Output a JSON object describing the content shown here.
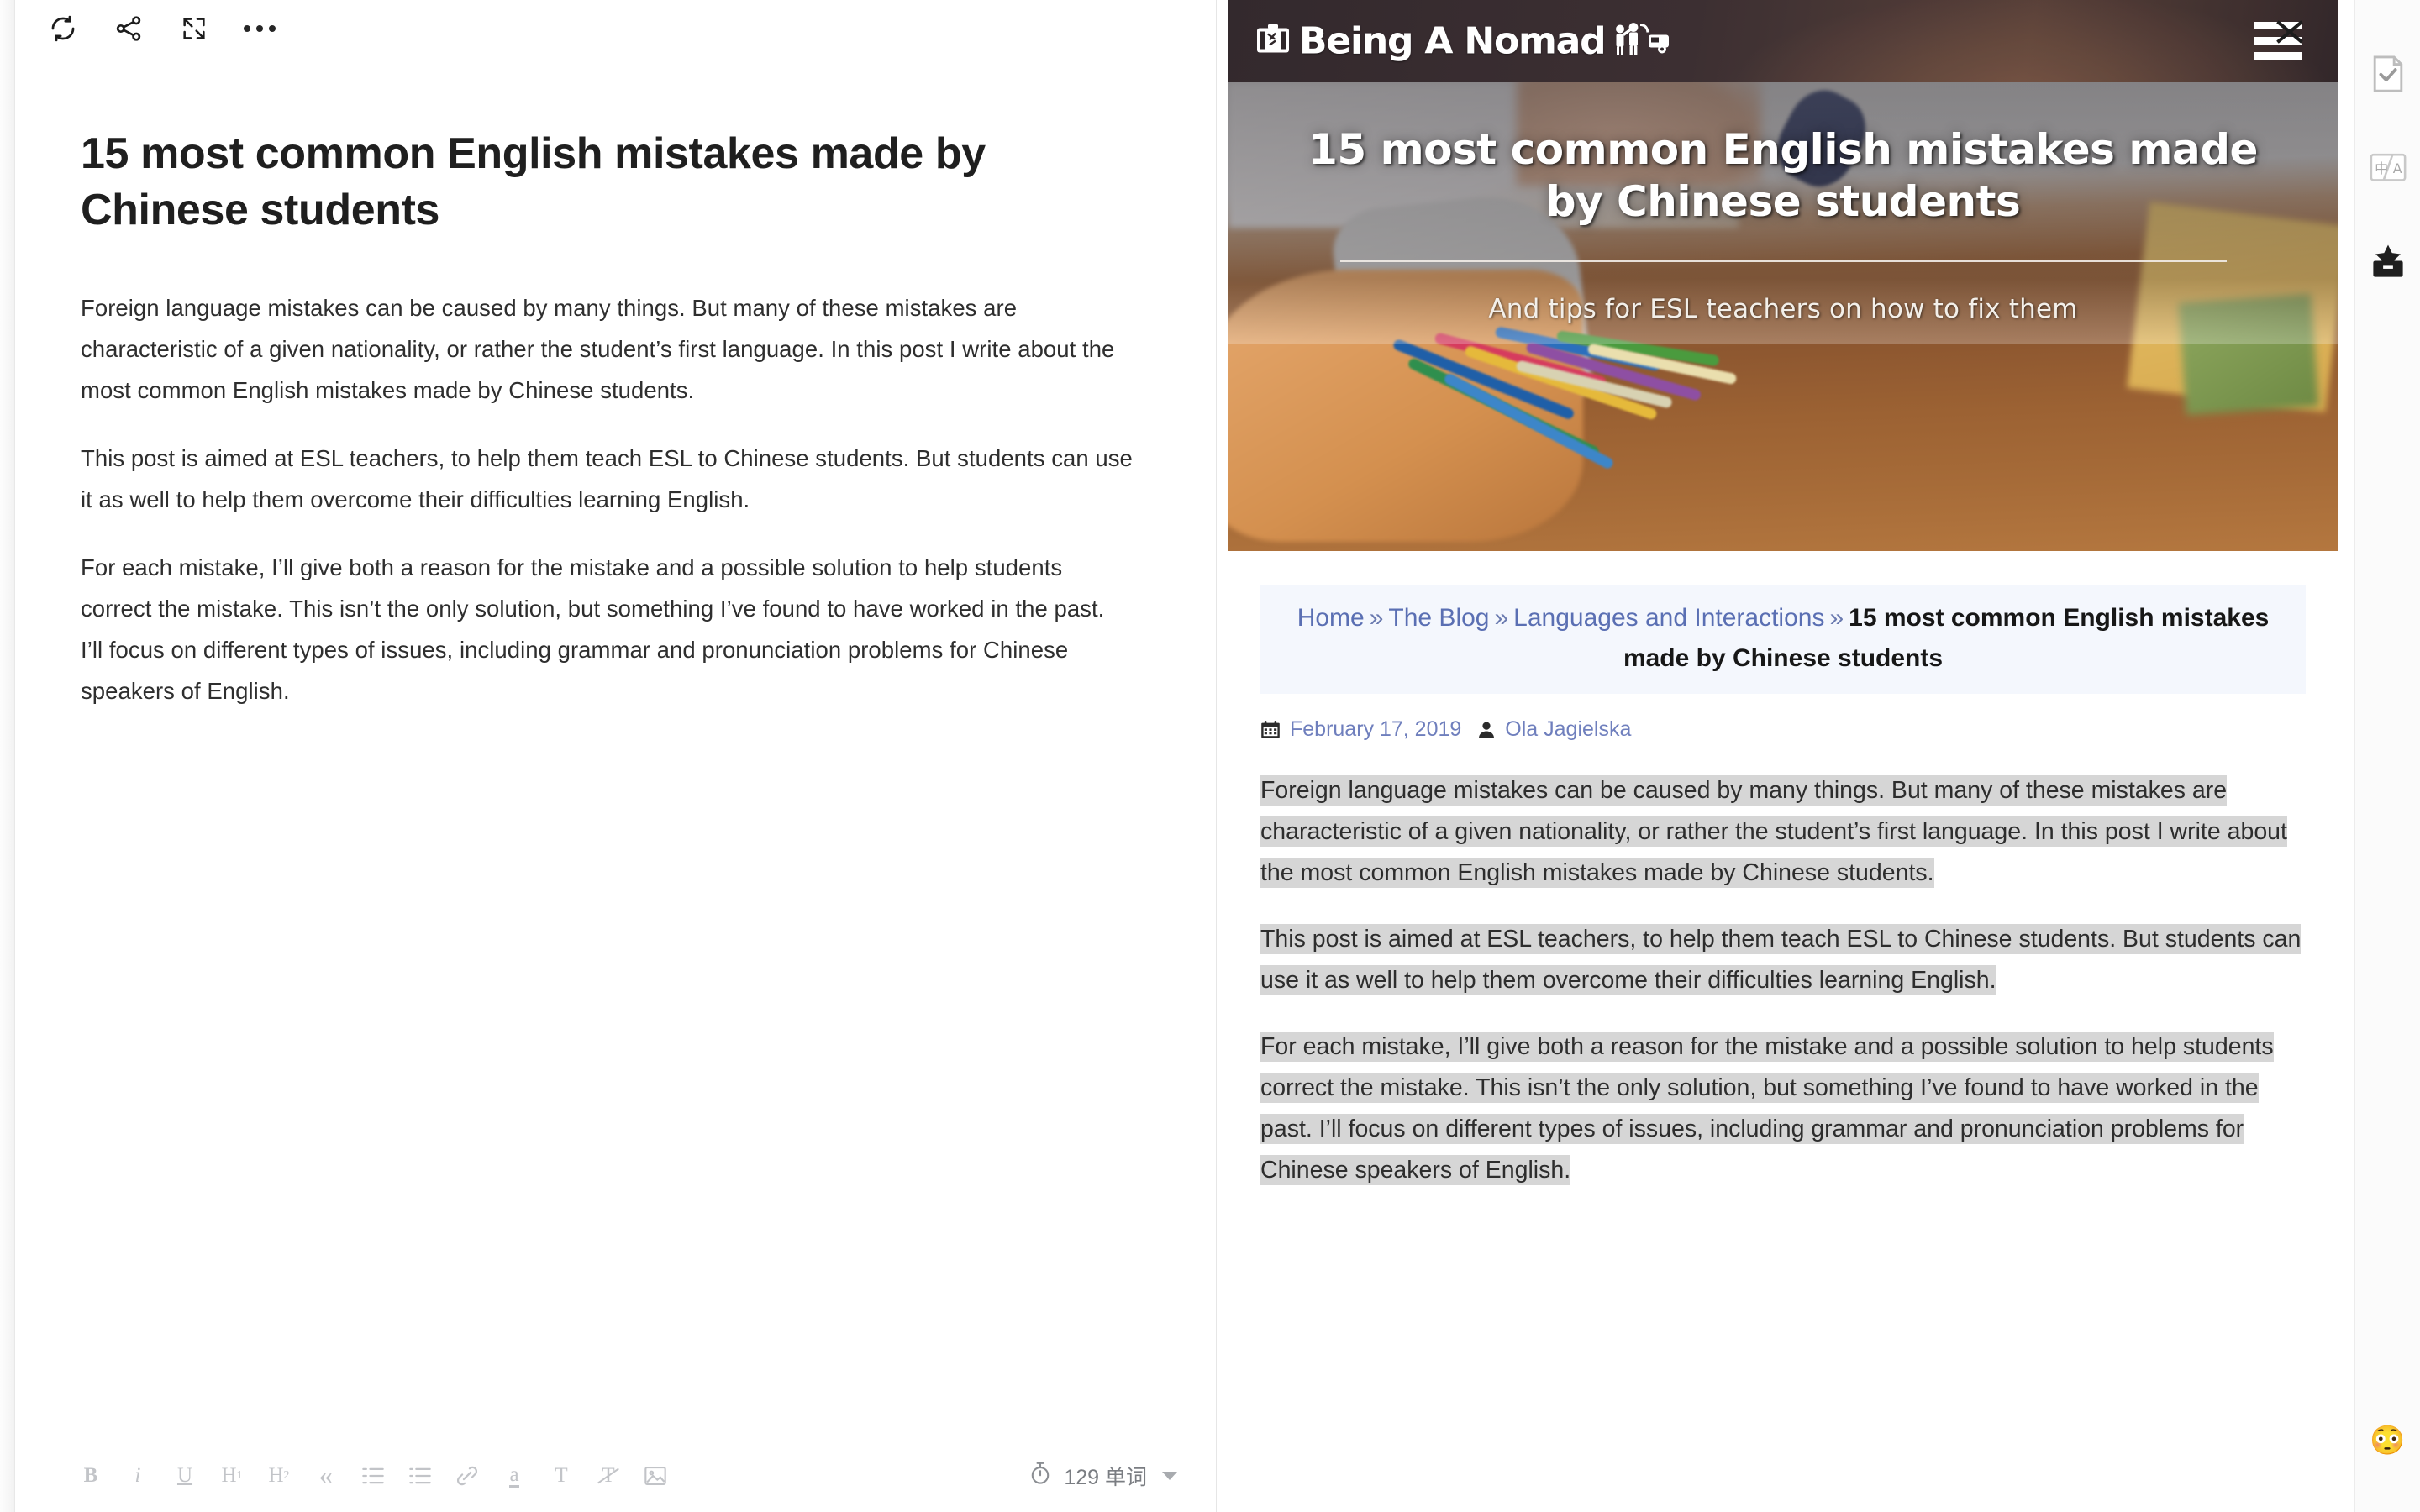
{
  "editor": {
    "toolbar_top": [
      {
        "name": "refresh-sync-icon",
        "label": "Sync"
      },
      {
        "name": "share-icon",
        "label": "Share"
      },
      {
        "name": "fullscreen-icon",
        "label": "Fullscreen"
      },
      {
        "name": "more-options-icon",
        "label": "More"
      }
    ],
    "title": "15 most common English mistakes made by Chinese students",
    "paragraphs": [
      "Foreign language mistakes can be caused by many things. But many of these mistakes are characteristic of a given nationality, or rather the student’s first language. In this post I write about the most common English mistakes made by Chinese students.",
      "This post is aimed at ESL teachers, to help them teach ESL to Chinese students. But students can use it as well to help them overcome their difficulties learning English.",
      "For each mistake, I’ll give both a reason for the mistake and a possible solution to help students correct the mistake. This isn’t the only solution, but something I’ve found to have worked in the past. I’ll focus on different types of issues, including grammar and pronunciation problems for Chinese speakers of English."
    ],
    "format_toolbar": [
      {
        "name": "bold-button",
        "label": "B"
      },
      {
        "name": "italic-button",
        "label": "i"
      },
      {
        "name": "underline-button",
        "label": "U"
      },
      {
        "name": "heading-1-button",
        "label": "H1"
      },
      {
        "name": "heading-2-button",
        "label": "H2"
      },
      {
        "name": "blockquote-button",
        "label": "«"
      },
      {
        "name": "ordered-list-button",
        "label": "ordered-list"
      },
      {
        "name": "bullet-list-button",
        "label": "bullet-list"
      },
      {
        "name": "link-button",
        "label": "link"
      },
      {
        "name": "highlight-button",
        "label": "a"
      },
      {
        "name": "text-color-button",
        "label": "T"
      },
      {
        "name": "clear-format-button",
        "label": "clear"
      },
      {
        "name": "insert-image-button",
        "label": "image"
      }
    ],
    "word_count": "129 单词"
  },
  "preview": {
    "site": {
      "logo_text": "Being A Nomad",
      "menu_label": "Menu"
    },
    "hero": {
      "title": "15 most common English mistakes made by Chinese students",
      "subtitle": "And tips for ESL teachers on how to fix them"
    },
    "breadcrumb": {
      "items": [
        {
          "label": "Home",
          "link": true
        },
        {
          "label": "The Blog",
          "link": true
        },
        {
          "label": "Languages and Interactions",
          "link": true
        }
      ],
      "separator": "»",
      "current": "15 most common English mistakes made by Chinese students"
    },
    "meta": {
      "date": "February 17, 2019",
      "author": "Ola Jagielska"
    },
    "paragraphs": [
      "Foreign language mistakes can be caused by many things. But many of these mistakes are characteristic of a given nationality, or rather the student’s first language. In this post I write about the most common English mistakes made by Chinese students.",
      "This post is aimed at ESL teachers, to help them teach ESL to Chinese students. But students can use it as well to help them overcome their difficulties learning English.",
      "For each mistake, I’ll give both a reason for the mistake and a possible solution to help students correct the mistake. This isn’t the only solution, but something I’ve found to have worked in the past. I’ll focus on different types of issues, including grammar and pronunciation problems for Chinese speakers of English."
    ]
  },
  "right_rail": {
    "items": [
      {
        "name": "task-check-document-icon",
        "label": "Proofread"
      },
      {
        "name": "translate-icon",
        "label": "Translate"
      },
      {
        "name": "toolbox-icon",
        "label": "Toolbox"
      }
    ],
    "emoji": "😳"
  },
  "colors": {
    "header_bg": "#2e2629",
    "breadcrumb_bg": "#f4f7fd",
    "link": "#5a6fb3",
    "selection": "#d6d6d6",
    "icon_muted": "#c2c4c8"
  }
}
